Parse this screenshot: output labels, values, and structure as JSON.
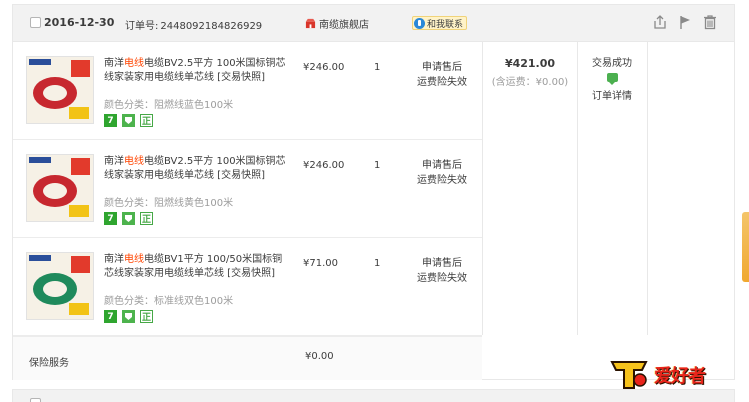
{
  "order": {
    "date": "2016-12-30",
    "order_no_label": "订单号:",
    "order_no": "2448092184826929",
    "shop_name": "南缆旗舰店",
    "contact_label": "和我联系",
    "total_amount": "¥421.00",
    "shipping_note": "(含运费：¥0.00)",
    "status": "交易成功",
    "detail_link": "订单详情",
    "items": [
      {
        "title_pre": "南洋",
        "title_hl": "电线",
        "title_post": "电缆BV2.5平方 100米国标铜芯线家装家用电缆线单芯线 [交易快照]",
        "sku": "颜色分类：阻燃线蓝色100米",
        "price": "¥246.00",
        "qty": "1",
        "service_line1": "申请售后",
        "service_line2": "运费险失效",
        "coil_color": "#c7282f"
      },
      {
        "title_pre": "南洋",
        "title_hl": "电线",
        "title_post": "电缆BV2.5平方 100米国标铜芯线家装家用电缆线单芯线 [交易快照]",
        "sku": "颜色分类：阻燃线黄色100米",
        "price": "¥246.00",
        "qty": "1",
        "service_line1": "申请售后",
        "service_line2": "运费险失效",
        "coil_color": "#c7282f"
      },
      {
        "title_pre": "南洋",
        "title_hl": "电线",
        "title_post": "电缆BV1平方 100/50米国标铜芯线家装家用电缆线单芯线 [交易快照]",
        "sku": "颜色分类：标准线双色100米",
        "price": "¥71.00",
        "qty": "1",
        "service_line1": "申请售后",
        "service_line2": "运费险失效",
        "coil_color": "#1f8a5c"
      }
    ],
    "insurance_label": "保险服务",
    "insurance_price": "¥0.00"
  },
  "badges": {
    "seven": "7",
    "zheng": "正"
  },
  "watermark": {
    "text": "爱好者"
  },
  "colors": {
    "highlight": "#ff4400",
    "header_bg": "#f2f2f2",
    "border": "#e8e8e8"
  }
}
